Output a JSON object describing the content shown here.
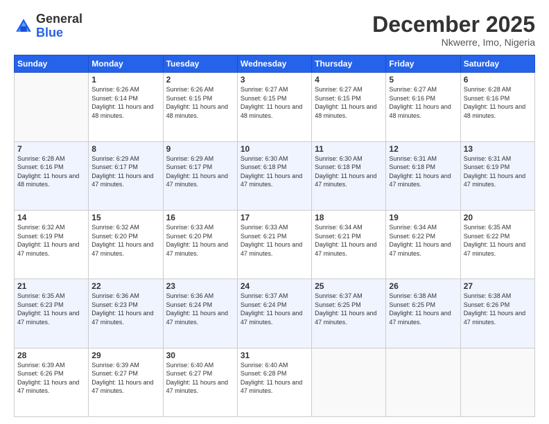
{
  "logo": {
    "general": "General",
    "blue": "Blue"
  },
  "header": {
    "month": "December 2025",
    "location": "Nkwerre, Imo, Nigeria"
  },
  "weekdays": [
    "Sunday",
    "Monday",
    "Tuesday",
    "Wednesday",
    "Thursday",
    "Friday",
    "Saturday"
  ],
  "weeks": [
    [
      {
        "day": "",
        "sunrise": "",
        "sunset": "",
        "daylight": "",
        "empty": true
      },
      {
        "day": "1",
        "sunrise": "Sunrise: 6:26 AM",
        "sunset": "Sunset: 6:14 PM",
        "daylight": "Daylight: 11 hours and 48 minutes."
      },
      {
        "day": "2",
        "sunrise": "Sunrise: 6:26 AM",
        "sunset": "Sunset: 6:15 PM",
        "daylight": "Daylight: 11 hours and 48 minutes."
      },
      {
        "day": "3",
        "sunrise": "Sunrise: 6:27 AM",
        "sunset": "Sunset: 6:15 PM",
        "daylight": "Daylight: 11 hours and 48 minutes."
      },
      {
        "day": "4",
        "sunrise": "Sunrise: 6:27 AM",
        "sunset": "Sunset: 6:15 PM",
        "daylight": "Daylight: 11 hours and 48 minutes."
      },
      {
        "day": "5",
        "sunrise": "Sunrise: 6:27 AM",
        "sunset": "Sunset: 6:16 PM",
        "daylight": "Daylight: 11 hours and 48 minutes."
      },
      {
        "day": "6",
        "sunrise": "Sunrise: 6:28 AM",
        "sunset": "Sunset: 6:16 PM",
        "daylight": "Daylight: 11 hours and 48 minutes."
      }
    ],
    [
      {
        "day": "7",
        "sunrise": "Sunrise: 6:28 AM",
        "sunset": "Sunset: 6:16 PM",
        "daylight": "Daylight: 11 hours and 48 minutes."
      },
      {
        "day": "8",
        "sunrise": "Sunrise: 6:29 AM",
        "sunset": "Sunset: 6:17 PM",
        "daylight": "Daylight: 11 hours and 47 minutes."
      },
      {
        "day": "9",
        "sunrise": "Sunrise: 6:29 AM",
        "sunset": "Sunset: 6:17 PM",
        "daylight": "Daylight: 11 hours and 47 minutes."
      },
      {
        "day": "10",
        "sunrise": "Sunrise: 6:30 AM",
        "sunset": "Sunset: 6:18 PM",
        "daylight": "Daylight: 11 hours and 47 minutes."
      },
      {
        "day": "11",
        "sunrise": "Sunrise: 6:30 AM",
        "sunset": "Sunset: 6:18 PM",
        "daylight": "Daylight: 11 hours and 47 minutes."
      },
      {
        "day": "12",
        "sunrise": "Sunrise: 6:31 AM",
        "sunset": "Sunset: 6:18 PM",
        "daylight": "Daylight: 11 hours and 47 minutes."
      },
      {
        "day": "13",
        "sunrise": "Sunrise: 6:31 AM",
        "sunset": "Sunset: 6:19 PM",
        "daylight": "Daylight: 11 hours and 47 minutes."
      }
    ],
    [
      {
        "day": "14",
        "sunrise": "Sunrise: 6:32 AM",
        "sunset": "Sunset: 6:19 PM",
        "daylight": "Daylight: 11 hours and 47 minutes."
      },
      {
        "day": "15",
        "sunrise": "Sunrise: 6:32 AM",
        "sunset": "Sunset: 6:20 PM",
        "daylight": "Daylight: 11 hours and 47 minutes."
      },
      {
        "day": "16",
        "sunrise": "Sunrise: 6:33 AM",
        "sunset": "Sunset: 6:20 PM",
        "daylight": "Daylight: 11 hours and 47 minutes."
      },
      {
        "day": "17",
        "sunrise": "Sunrise: 6:33 AM",
        "sunset": "Sunset: 6:21 PM",
        "daylight": "Daylight: 11 hours and 47 minutes."
      },
      {
        "day": "18",
        "sunrise": "Sunrise: 6:34 AM",
        "sunset": "Sunset: 6:21 PM",
        "daylight": "Daylight: 11 hours and 47 minutes."
      },
      {
        "day": "19",
        "sunrise": "Sunrise: 6:34 AM",
        "sunset": "Sunset: 6:22 PM",
        "daylight": "Daylight: 11 hours and 47 minutes."
      },
      {
        "day": "20",
        "sunrise": "Sunrise: 6:35 AM",
        "sunset": "Sunset: 6:22 PM",
        "daylight": "Daylight: 11 hours and 47 minutes."
      }
    ],
    [
      {
        "day": "21",
        "sunrise": "Sunrise: 6:35 AM",
        "sunset": "Sunset: 6:23 PM",
        "daylight": "Daylight: 11 hours and 47 minutes."
      },
      {
        "day": "22",
        "sunrise": "Sunrise: 6:36 AM",
        "sunset": "Sunset: 6:23 PM",
        "daylight": "Daylight: 11 hours and 47 minutes."
      },
      {
        "day": "23",
        "sunrise": "Sunrise: 6:36 AM",
        "sunset": "Sunset: 6:24 PM",
        "daylight": "Daylight: 11 hours and 47 minutes."
      },
      {
        "day": "24",
        "sunrise": "Sunrise: 6:37 AM",
        "sunset": "Sunset: 6:24 PM",
        "daylight": "Daylight: 11 hours and 47 minutes."
      },
      {
        "day": "25",
        "sunrise": "Sunrise: 6:37 AM",
        "sunset": "Sunset: 6:25 PM",
        "daylight": "Daylight: 11 hours and 47 minutes."
      },
      {
        "day": "26",
        "sunrise": "Sunrise: 6:38 AM",
        "sunset": "Sunset: 6:25 PM",
        "daylight": "Daylight: 11 hours and 47 minutes."
      },
      {
        "day": "27",
        "sunrise": "Sunrise: 6:38 AM",
        "sunset": "Sunset: 6:26 PM",
        "daylight": "Daylight: 11 hours and 47 minutes."
      }
    ],
    [
      {
        "day": "28",
        "sunrise": "Sunrise: 6:39 AM",
        "sunset": "Sunset: 6:26 PM",
        "daylight": "Daylight: 11 hours and 47 minutes."
      },
      {
        "day": "29",
        "sunrise": "Sunrise: 6:39 AM",
        "sunset": "Sunset: 6:27 PM",
        "daylight": "Daylight: 11 hours and 47 minutes."
      },
      {
        "day": "30",
        "sunrise": "Sunrise: 6:40 AM",
        "sunset": "Sunset: 6:27 PM",
        "daylight": "Daylight: 11 hours and 47 minutes."
      },
      {
        "day": "31",
        "sunrise": "Sunrise: 6:40 AM",
        "sunset": "Sunset: 6:28 PM",
        "daylight": "Daylight: 11 hours and 47 minutes."
      },
      {
        "day": "",
        "sunrise": "",
        "sunset": "",
        "daylight": "",
        "empty": true
      },
      {
        "day": "",
        "sunrise": "",
        "sunset": "",
        "daylight": "",
        "empty": true
      },
      {
        "day": "",
        "sunrise": "",
        "sunset": "",
        "daylight": "",
        "empty": true
      }
    ]
  ]
}
